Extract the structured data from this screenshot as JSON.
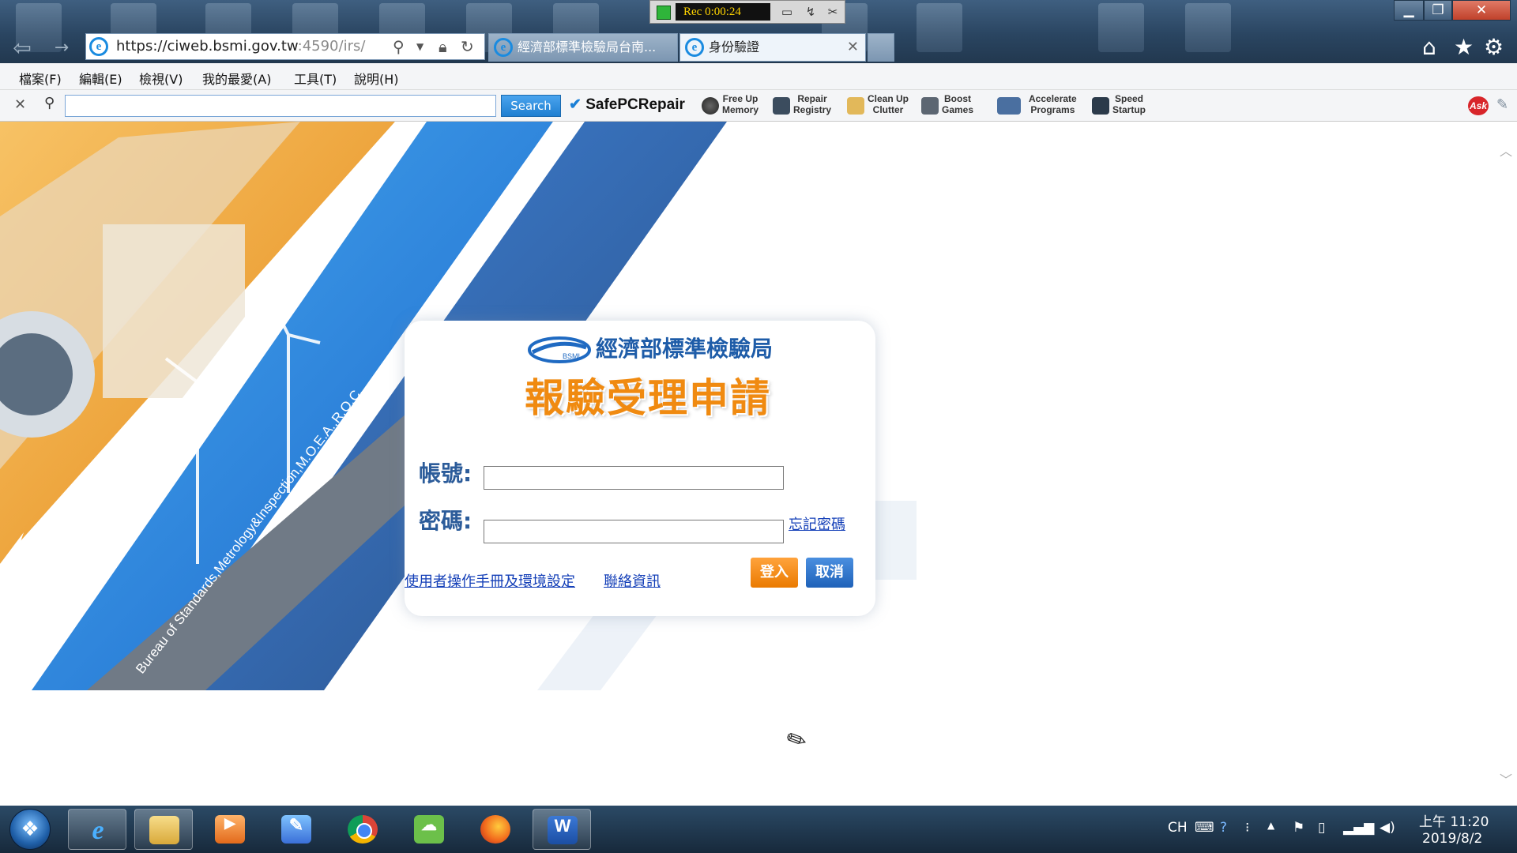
{
  "recorder": {
    "time": "Rec 0:00:24"
  },
  "browser": {
    "url_host": "https://ciweb.bsmi.gov.tw",
    "url_rest": ":4590/irs/",
    "tabs": [
      {
        "label": "經濟部標準檢驗局台南...",
        "active": false
      },
      {
        "label": "身份驗證",
        "active": true
      }
    ]
  },
  "menu": [
    "檔案(F)",
    "編輯(E)",
    "檢視(V)",
    "我的最愛(A)",
    "工具(T)",
    "說明(H)"
  ],
  "toolbar": {
    "search_label": "Search",
    "brand": "SafePCRepair",
    "items": [
      {
        "label": "Free Up\nMemory",
        "icon": "memory-icon"
      },
      {
        "label": "Repair\nRegistry",
        "icon": "registry-icon"
      },
      {
        "label": "Clean Up\nClutter",
        "icon": "broom-icon"
      },
      {
        "label": "Boost\nGames",
        "icon": "gamepad-icon"
      },
      {
        "label": "Accelerate\nPrograms",
        "icon": "programs-icon"
      },
      {
        "label": "Speed\nStartup",
        "icon": "startup-icon"
      }
    ],
    "ask_label": "Ask"
  },
  "banner": {
    "slogan": "Bureau of Standards,Metrology&Inspection,M.O.E.A.,R.O.C."
  },
  "login": {
    "org_name": "經濟部標準檢驗局",
    "logo_text": "BSMI",
    "app_title": "報驗受理申請",
    "account_label": "帳號:",
    "password_label": "密碼:",
    "forgot_password": "忘記密碼",
    "manual_link": "使用者操作手冊及環境設定",
    "contact_link": "聯絡資訊",
    "login_button": "登入",
    "cancel_button": "取消"
  },
  "taskbar": {
    "apps": [
      "internet-explorer",
      "file-explorer",
      "media-player",
      "paint-tool",
      "chrome",
      "wechat",
      "firefox",
      "word"
    ],
    "ime": "CH",
    "time": "上午 11:20",
    "date": "2019/8/2"
  }
}
